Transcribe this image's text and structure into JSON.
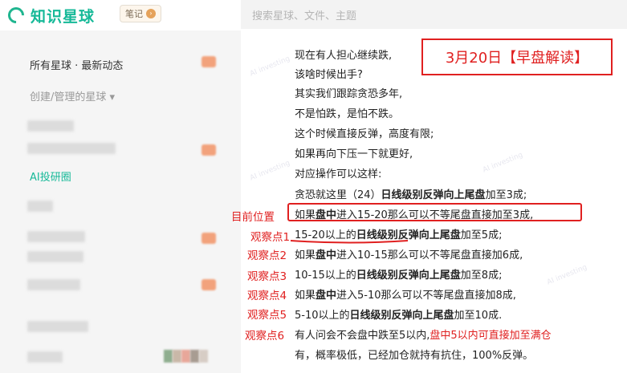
{
  "header": {
    "logo_text": "知识星球",
    "notes_label": "笔记",
    "search_placeholder": "搜索星球、文件、主题"
  },
  "sidebar": {
    "all_feed": "所有星球 · 最新动态",
    "created_managed": "创建/管理的星球",
    "ai_item": "AI投研圈"
  },
  "post": {
    "title_stamp": "3月20日【早盘解读】",
    "lines": {
      "l1": "现在有人担心继续跌,",
      "l2": "该啥时候出手?",
      "l3": "其实我们跟踪贪恐多年,",
      "l4": "不是怕跌，是怕不跌。",
      "l5": "这个时候直接反弹，高度有限;",
      "l6": "如果再向下压一下就更好,",
      "l7": "对应操作可以这样:",
      "l8a": "贪恐就这里（24）",
      "l8b": "日线级别反弹向上尾盘",
      "l8c": "加至3成;",
      "l9a": "如果",
      "l9b": "盘中",
      "l9c": "进入15-20那么可以不等尾盘直接加至3成,",
      "l10a": "15-20以上的",
      "l10b": "日线级别反弹向上尾盘",
      "l10c": "加至5成;",
      "l11a": "如果",
      "l11b": "盘中",
      "l11c": "进入10-15那么可以不等尾盘直接加6成,",
      "l12a": "10-15以上的",
      "l12b": "日线级别反弹向上尾盘",
      "l12c": "加至8成;",
      "l13a": "如果",
      "l13b": "盘中",
      "l13c": "进入5-10那么可以不等尾盘直接加8成,",
      "l14a": "5-10以上的",
      "l14b": "日线级别反弹向上尾盘",
      "l14c": "加至10成.",
      "l15a": "有人问会不会盘中跌至5以内,",
      "l15b": "盘中5以内可直接加至满仓",
      "l16": "有，概率极低，已经加仓就持有抗住，100%反弹。"
    },
    "annotations": {
      "current": "目前位置",
      "obs1": "观察点1",
      "obs2": "观察点2",
      "obs3": "观察点3",
      "obs4": "观察点4",
      "obs5": "观察点5",
      "obs6": "观察点6"
    }
  },
  "colors": {
    "brand": "#16b998",
    "annotation_red": "#e02020",
    "sidebar_bg": "#f5f5f5"
  }
}
